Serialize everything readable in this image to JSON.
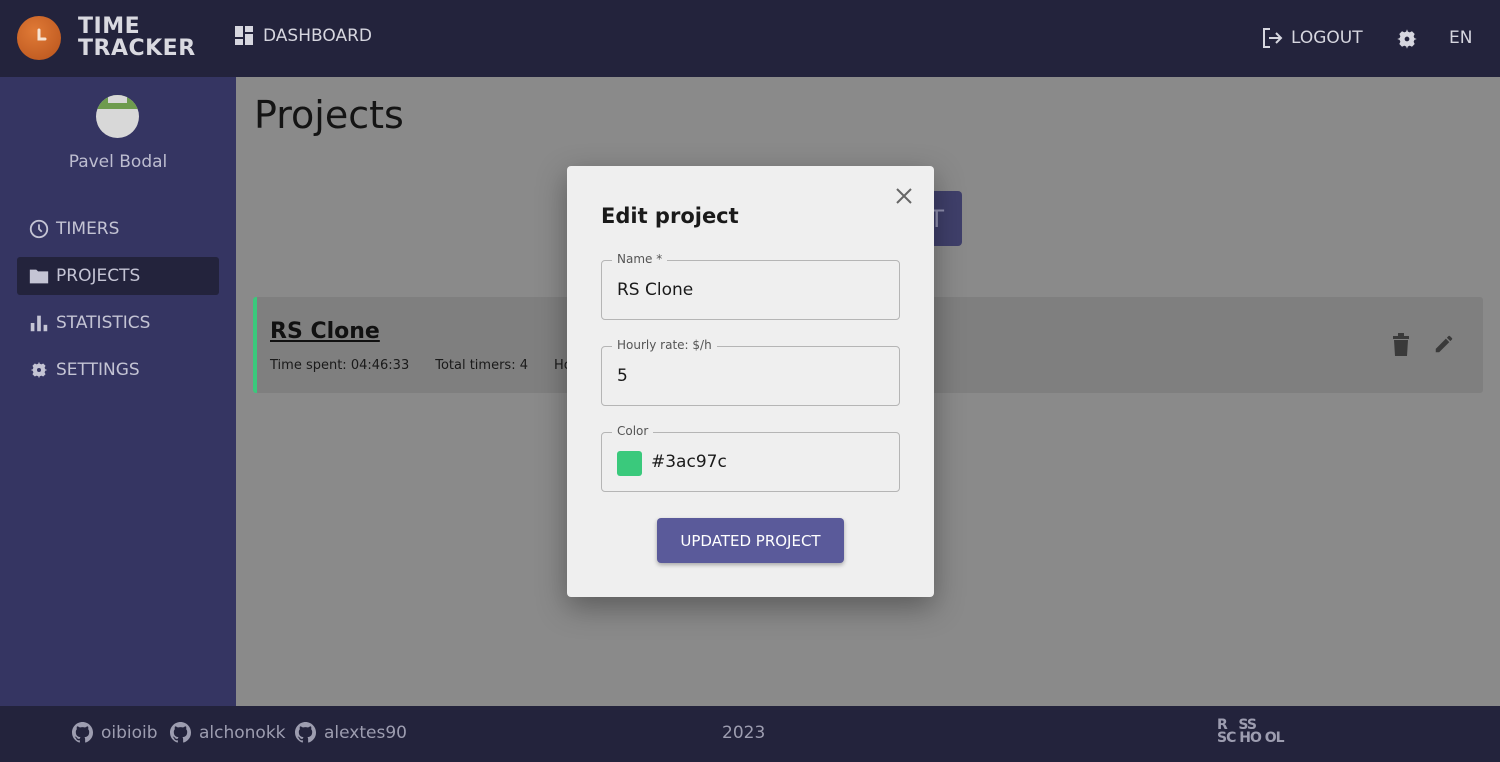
{
  "header": {
    "logo_text_line1": "TIME",
    "logo_text_line2": "TRACKER",
    "dashboard_label": "DASHBOARD",
    "logout_label": "LOGOUT",
    "language": "EN",
    "colors": {
      "background": "#23233c",
      "logo": "#d9702f"
    }
  },
  "sidebar": {
    "username": "Pavel Bodal",
    "items": [
      {
        "label": "TIMERS",
        "icon": "clock-icon"
      },
      {
        "label": "PROJECTS",
        "icon": "folder-icon",
        "active": true
      },
      {
        "label": "STATISTICS",
        "icon": "bar-chart-icon"
      },
      {
        "label": "SETTINGS",
        "icon": "gear-icon"
      }
    ]
  },
  "main": {
    "title": "Projects",
    "add_button_partial": "T",
    "project": {
      "name": "RS Clone",
      "time_spent_label": "Time spent:",
      "time_spent_value": "04:46:33",
      "total_timers_label": "Total timers:",
      "total_timers_value": "4",
      "hourly_partial": "Hourl",
      "color": "#3ac97c"
    }
  },
  "modal": {
    "title": "Edit project",
    "name_label": "Name *",
    "name_value": "RS Clone",
    "rate_label": "Hourly rate: $/h",
    "rate_value": "5",
    "color_label": "Color",
    "color_value": "#3ac97c",
    "submit_label": "UPDATED PROJECT"
  },
  "footer": {
    "github_users": [
      "oibioib",
      "alchonokk",
      "alextes90"
    ],
    "year": "2023",
    "school_logo_line1": "R   SS",
    "school_logo_line2": "SC HO OL"
  }
}
